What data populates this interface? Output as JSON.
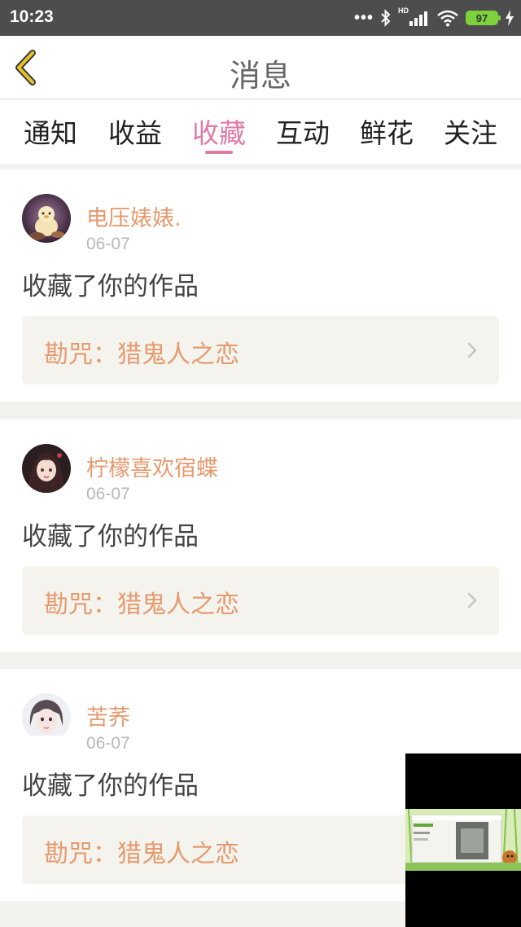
{
  "status_bar": {
    "time": "10:23",
    "signal_dots": "•••",
    "hd_label": "HD",
    "battery_level": "97"
  },
  "header": {
    "title": "消息"
  },
  "tabs": [
    {
      "label": "通知",
      "active": false
    },
    {
      "label": "收益",
      "active": false
    },
    {
      "label": "收藏",
      "active": true
    },
    {
      "label": "互动",
      "active": false
    },
    {
      "label": "鲜花",
      "active": false
    },
    {
      "label": "关注",
      "active": false
    }
  ],
  "messages": [
    {
      "user": "电压婊婊.",
      "date": "06-07",
      "text": "收藏了你的作品",
      "work": "勘咒：猎鬼人之恋"
    },
    {
      "user": "柠檬喜欢宿蝶",
      "date": "06-07",
      "text": "收藏了你的作品",
      "work": "勘咒：猎鬼人之恋"
    },
    {
      "user": "苦荞",
      "date": "06-07",
      "text": "收藏了你的作品",
      "work": "勘咒：猎鬼人之恋"
    }
  ],
  "colors": {
    "accent_pink": "#e07aa6",
    "name_orange": "#e59a6e",
    "back_yellow": "#e8c22a"
  }
}
